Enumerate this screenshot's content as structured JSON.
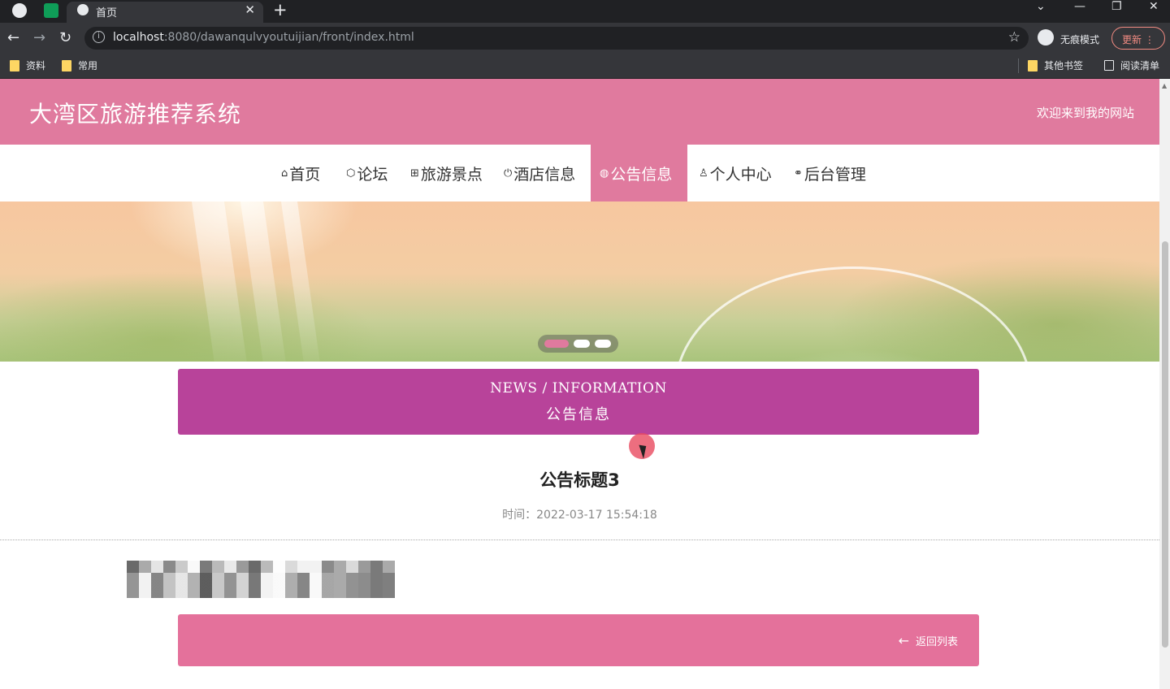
{
  "browser": {
    "tab_title": "首页",
    "url_host": "localhost",
    "url_rest": ":8080/dawanqulvyoutuijian/front/index.html",
    "incognito_label": "无痕模式",
    "update_label": "更新",
    "bookmarks": [
      "资料",
      "常用"
    ],
    "other_bookmarks": "其他书签",
    "reading_list": "阅读清单"
  },
  "header": {
    "site_title": "大湾区旅游推荐系统",
    "welcome": "欢迎来到我的网站"
  },
  "nav": {
    "items": [
      {
        "label": "首页",
        "icon": "home-icon",
        "glyph": "⌂"
      },
      {
        "label": "论坛",
        "icon": "cube-icon",
        "glyph": "⬡"
      },
      {
        "label": "旅游景点",
        "icon": "gift-icon",
        "glyph": "⊞"
      },
      {
        "label": "酒店信息",
        "icon": "power-icon",
        "glyph": "⏻"
      },
      {
        "label": "公告信息",
        "icon": "dribbble-icon",
        "glyph": "◍"
      },
      {
        "label": "个人中心",
        "icon": "user-icon",
        "glyph": "♙"
      },
      {
        "label": "后台管理",
        "icon": "link-icon",
        "glyph": "⚭"
      }
    ],
    "active_index": 4
  },
  "carousel": {
    "slide_count": 3,
    "active_slide": 1
  },
  "section": {
    "title_en": "NEWS / INFORMATION",
    "title_cn": "公告信息"
  },
  "detail": {
    "title": "公告标题3",
    "time": "时间：2022-03-17 15:54:18"
  },
  "footer": {
    "back_label": "返回列表"
  },
  "colors": {
    "brand_pink": "#e07a9e",
    "section_purple": "#b8439a"
  }
}
